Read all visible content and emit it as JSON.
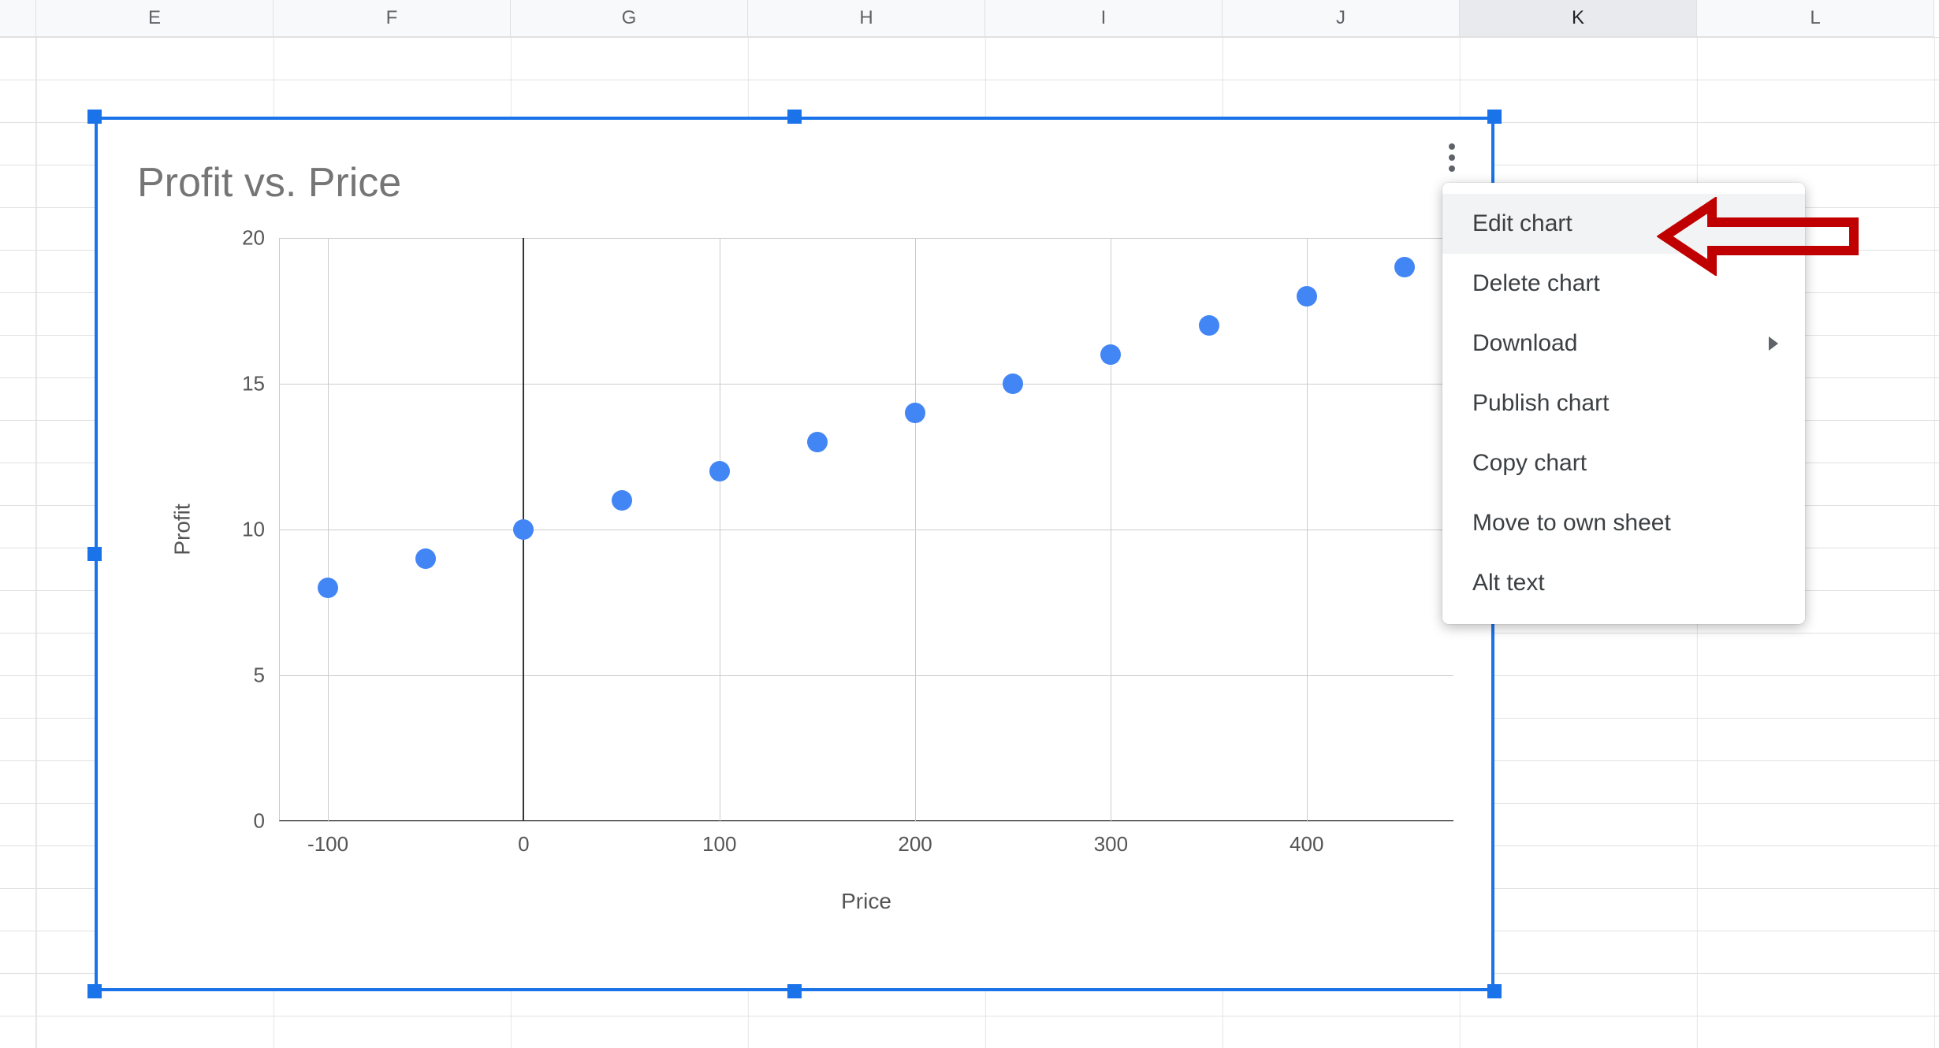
{
  "columns": [
    "E",
    "F",
    "G",
    "H",
    "I",
    "J",
    "K",
    "L"
  ],
  "selected_column_index": 6,
  "chart_data": {
    "type": "scatter",
    "title": "Profit vs. Price",
    "xlabel": "Price",
    "ylabel": "Profit",
    "xlim": [
      -125,
      475
    ],
    "ylim": [
      0,
      20
    ],
    "x_ticks": [
      -100,
      0,
      100,
      200,
      300,
      400
    ],
    "y_ticks": [
      0,
      5,
      10,
      15,
      20
    ],
    "x": [
      -100,
      -50,
      0,
      50,
      100,
      150,
      200,
      250,
      300,
      350,
      400,
      450
    ],
    "y": [
      8,
      9,
      10,
      11,
      12,
      13,
      14,
      15,
      16,
      17,
      18,
      19
    ],
    "point_color": "#4285f4"
  },
  "menu": {
    "items": [
      {
        "id": "edit",
        "label": "Edit chart",
        "hover": true,
        "submenu": false
      },
      {
        "id": "delete",
        "label": "Delete chart",
        "hover": false,
        "submenu": false
      },
      {
        "id": "download",
        "label": "Download",
        "hover": false,
        "submenu": true
      },
      {
        "id": "publish",
        "label": "Publish chart",
        "hover": false,
        "submenu": false
      },
      {
        "id": "copy",
        "label": "Copy chart",
        "hover": false,
        "submenu": false
      },
      {
        "id": "move",
        "label": "Move to own sheet",
        "hover": false,
        "submenu": false
      },
      {
        "id": "alt",
        "label": "Alt text",
        "hover": false,
        "submenu": false
      }
    ]
  }
}
